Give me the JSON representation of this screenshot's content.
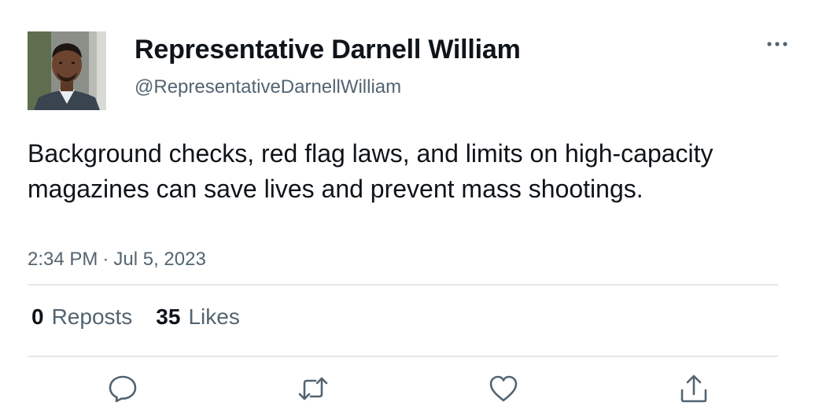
{
  "user": {
    "display_name": "Representative Darnell William",
    "handle": "@RepresentativeDarnellWilliam"
  },
  "tweet": {
    "text": "Background checks, red flag laws, and limits on high-capacity magazines can save lives and prevent mass shootings.",
    "time": "2:34 PM",
    "separator": "·",
    "date": "Jul 5, 2023"
  },
  "stats": {
    "reposts_count": "0",
    "reposts_label": "Reposts",
    "likes_count": "35",
    "likes_label": "Likes"
  },
  "icons": {
    "more": "more-horizontal-icon",
    "reply": "reply-icon",
    "repost": "repost-icon",
    "like": "like-icon",
    "share": "share-icon"
  },
  "colors": {
    "text_primary": "#0f1419",
    "text_secondary": "#536471",
    "divider": "#e3e7ea"
  }
}
